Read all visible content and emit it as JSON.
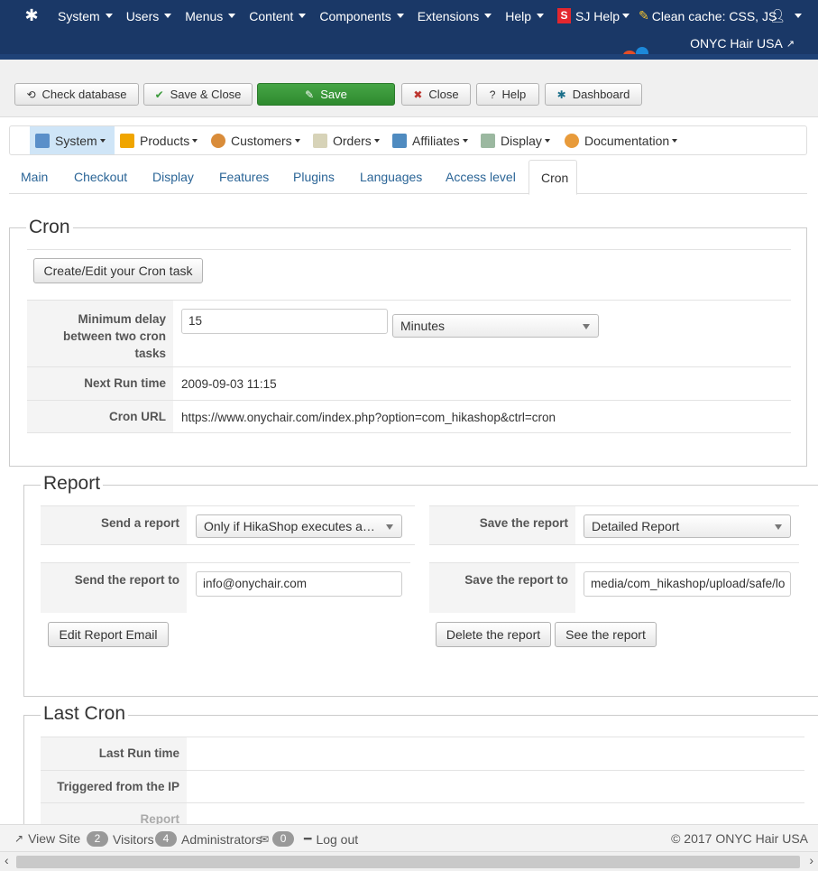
{
  "topbar": {
    "menu": [
      "System",
      "Users",
      "Menus",
      "Content",
      "Components",
      "Extensions",
      "Help"
    ],
    "sj_badge": "S",
    "sj_help": "SJ Help",
    "clean_cache": "Clean cache: CSS, JS",
    "user_icon": "user-icon",
    "site_name": "ONYC Hair USA"
  },
  "toolbar": {
    "check_database": "Check database",
    "save_close": "Save & Close",
    "save": "Save",
    "close": "Close",
    "help": "Help",
    "dashboard": "Dashboard"
  },
  "hikamenu": {
    "items": [
      "System",
      "Products",
      "Customers",
      "Orders",
      "Affiliates",
      "Display",
      "Documentation"
    ]
  },
  "tabs": [
    "Main",
    "Checkout",
    "Display",
    "Features",
    "Plugins",
    "Languages",
    "Access level",
    "Cron"
  ],
  "cron": {
    "legend": "Cron",
    "create_button": "Create/Edit your Cron task",
    "min_delay_label": "Minimum delay between two cron tasks",
    "min_delay_value": "15",
    "min_delay_unit": "Minutes",
    "next_run_label": "Next Run time",
    "next_run_value": "2009-09-03 11:15",
    "cron_url_label": "Cron URL",
    "cron_url_value": "https://www.onychair.com/index.php?option=com_hikashop&ctrl=cron"
  },
  "report": {
    "legend": "Report",
    "send_label": "Send a report",
    "send_value": "Only if HikaShop executes a…",
    "send_to_label": "Send the report to",
    "send_to_value": "info@onychair.com",
    "edit_email_button": "Edit Report Email",
    "save_label": "Save the report",
    "save_value": "Detailed Report",
    "save_to_label": "Save the report to",
    "save_to_value": "media/com_hikashop/upload/safe/lo",
    "delete_button": "Delete the report",
    "see_button": "See the report"
  },
  "last_cron": {
    "legend": "Last Cron",
    "last_run_label": "Last Run time",
    "triggered_label": "Triggered from the IP",
    "report_label": "Report"
  },
  "statusbar": {
    "view_site": "View Site",
    "visitors_count": "2",
    "visitors": "Visitors",
    "admins_count": "4",
    "administrators": "Administrators",
    "messages_count": "0",
    "logout": "Log out",
    "copyright": "© 2017 ONYC Hair USA"
  }
}
